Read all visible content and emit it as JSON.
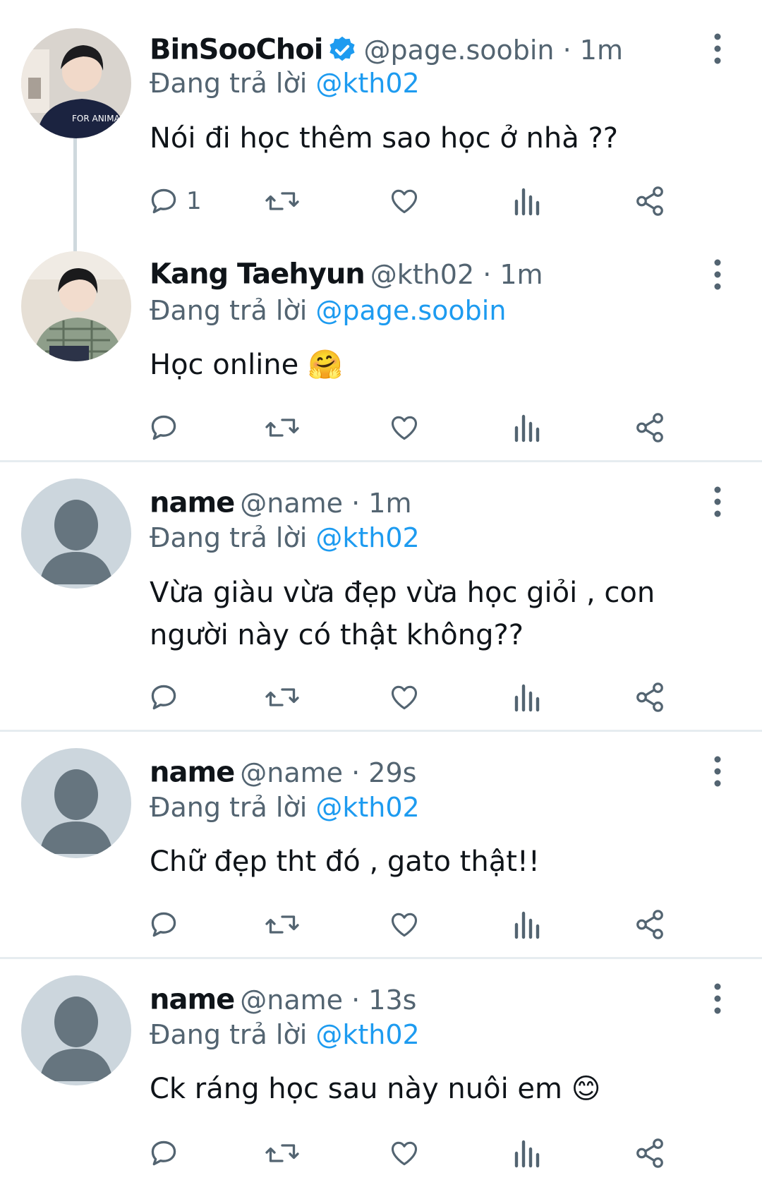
{
  "reply_prefix": "Đang trả lời",
  "icons": {
    "reply": "reply-bubble-icon",
    "retweet": "retweet-icon",
    "like": "heart-icon",
    "views": "views-bar-chart-icon",
    "share": "share-icon",
    "more": "more-vertical-icon",
    "verified": "verified-badge-icon"
  },
  "colors": {
    "link": "#1d9bf0",
    "muted": "#536471",
    "separator": "#e6ecf0",
    "default_avatar_bg": "#ccd6dd",
    "default_avatar_fg": "#66757f"
  },
  "tweets": [
    {
      "name": "BinSooChoi",
      "verified": true,
      "handle": "@page.soobin",
      "time": "1m",
      "reply_to": "@kth02",
      "text": "Nói đi học thêm sao học ở nhà ??",
      "reply_count": "1"
    },
    {
      "name": "Kang Taehyun",
      "verified": false,
      "handle": "@kth02",
      "time": "1m",
      "reply_to": "@page.soobin",
      "text": "Học online 🤗",
      "reply_count": ""
    },
    {
      "name": "name",
      "verified": false,
      "handle": "@name",
      "time": "1m",
      "reply_to": "@kth02",
      "text": "Vừa giàu vừa đẹp vừa học giỏi , con người này có thật không??",
      "reply_count": ""
    },
    {
      "name": "name",
      "verified": false,
      "handle": "@name",
      "time": "29s",
      "reply_to": "@kth02",
      "text": "Chữ đẹp tht đó , gato thật!!",
      "reply_count": ""
    },
    {
      "name": "name",
      "verified": false,
      "handle": "@name",
      "time": "13s",
      "reply_to": "@kth02",
      "text": "Ck ráng học sau này nuôi em 😊",
      "reply_count": ""
    }
  ]
}
